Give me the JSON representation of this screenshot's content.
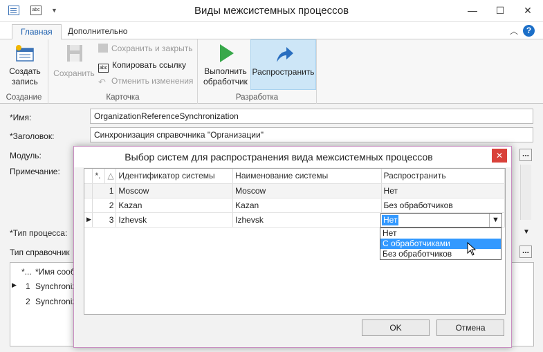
{
  "window": {
    "title": "Виды межсистемных процессов",
    "qa_abc": "abc"
  },
  "tabs": [
    {
      "label": "Главная"
    },
    {
      "label": "Дополнительно"
    }
  ],
  "ribbon": {
    "create": {
      "label_line1": "Создать",
      "label_line2": "запись",
      "group": "Создание"
    },
    "save": {
      "label": "Сохранить"
    },
    "card": {
      "save_close": "Сохранить и закрыть",
      "copy_link": "Копировать ссылку",
      "cancel_changes": "Отменить изменения",
      "group": "Карточка",
      "copy_icon_text": "abc"
    },
    "run": {
      "label_line1": "Выполнить",
      "label_line2": "обработчик"
    },
    "distribute": {
      "label": "Распространить"
    },
    "dev_group": "Разработка"
  },
  "form": {
    "name_label": "*Имя:",
    "name_value": "OrganizationReferenceSynchronization",
    "heading_label": "*Заголовок:",
    "heading_value": "Синхронизация справочника \"Организации\"",
    "module_label": "Модуль:",
    "note_label": "Примечание:",
    "process_type_label": "*Тип процесса:",
    "ref_type_label": "Тип справочник",
    "dots": "...",
    "grid": {
      "col_star": "*...",
      "col_msg": "*Имя сооб",
      "rows": [
        {
          "num": "1",
          "name": "Synchroniz"
        },
        {
          "num": "2",
          "name": "Synchroniz"
        }
      ]
    }
  },
  "dialog": {
    "title": "Выбор систем для распространения вида межсистемных процессов",
    "columns": {
      "num": "*.",
      "sort": "△",
      "id": "Идентификатор системы",
      "name": "Наименование системы",
      "distribute": "Распространить"
    },
    "rows": [
      {
        "num": "1",
        "id": "Moscow",
        "name": "Moscow",
        "distribute": "Нет"
      },
      {
        "num": "2",
        "id": "Kazan",
        "name": "Kazan",
        "distribute": "Без обработчиков"
      },
      {
        "num": "3",
        "id": "Izhevsk",
        "name": "Izhevsk",
        "distribute": "Нет"
      }
    ],
    "dropdown_options": [
      "Нет",
      "С обработчиками",
      "Без обработчиков"
    ],
    "dropdown_highlighted": "С обработчиками",
    "ok": "OK",
    "cancel": "Отмена"
  }
}
